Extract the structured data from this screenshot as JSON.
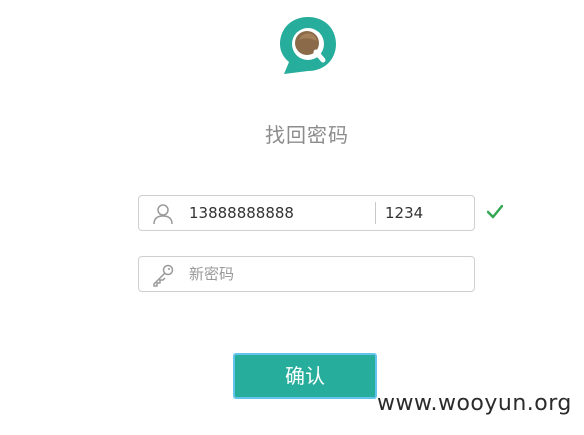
{
  "header": {
    "title": "找回密码",
    "logo_icon": "magnifier-chat-icon"
  },
  "form": {
    "phone": {
      "icon": "user-icon",
      "value": "13888888888",
      "code_value": "1234",
      "valid_icon": "check-icon"
    },
    "password": {
      "icon": "key-icon",
      "placeholder": "新密码"
    }
  },
  "actions": {
    "confirm_label": "确认"
  },
  "watermark": "www.wooyun.org",
  "colors": {
    "brand": "#26ad9b",
    "button_border": "#65c4ee",
    "check": "#34a853"
  }
}
